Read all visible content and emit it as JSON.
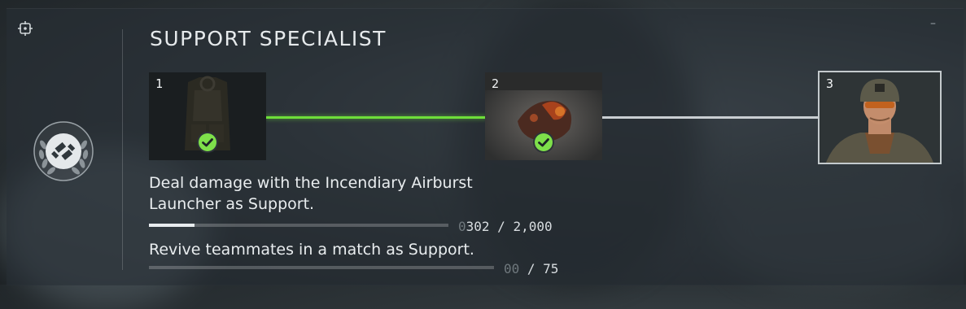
{
  "header": {
    "title": "SUPPORT SPECIALIST",
    "minimize_label": "–"
  },
  "icons": {
    "track": "crosshair-target-icon",
    "class_emblem": "support-class-laurel-emblem-icon",
    "check": "checkmark-icon"
  },
  "colors": {
    "complete_line": "#6ede3a",
    "pending_line": "#c9ced2",
    "check_green": "#7ee04a"
  },
  "stages": [
    {
      "number": "1",
      "status": "complete",
      "image": "tactical-vest"
    },
    {
      "number": "2",
      "status": "complete",
      "image": "incendiary-explosion"
    },
    {
      "number": "3",
      "status": "selected",
      "image": "support-soldier-portrait"
    }
  ],
  "objectives": [
    {
      "text": "Deal damage with the Incendiary Airburst",
      "text_line2": "Launcher as Support.",
      "progress_current_dim": "0",
      "progress_current": "302",
      "progress_sep": " / ",
      "progress_total": "2,000",
      "progress_fraction": 0.151
    },
    {
      "text": "Revive teammates in a match as Support.",
      "progress_current_dim": "00",
      "progress_current": "",
      "progress_sep": " / ",
      "progress_total": "75",
      "progress_fraction": 0.0
    }
  ]
}
